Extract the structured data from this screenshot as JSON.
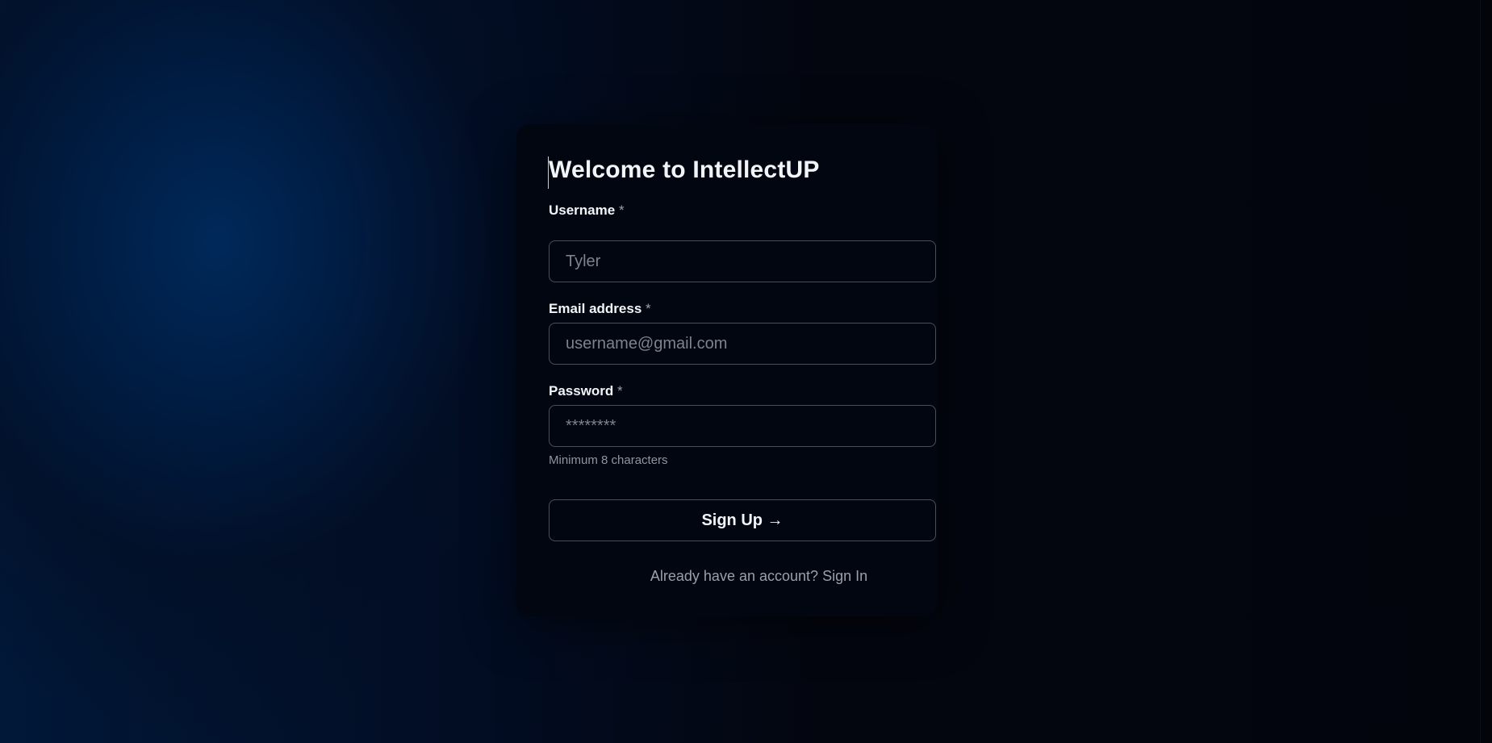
{
  "colors": {
    "background_accent": "#002a5c",
    "card_background": "#020611",
    "input_border": "#4a4f5a",
    "text_primary": "#f2f4f8",
    "text_muted": "#9aa0ab"
  },
  "form": {
    "title": "Welcome to IntellectUP",
    "username": {
      "label": "Username",
      "required_mark": "*",
      "placeholder": "Tyler",
      "value": ""
    },
    "email": {
      "label": "Email address",
      "required_mark": "*",
      "placeholder": "username@gmail.com",
      "value": ""
    },
    "password": {
      "label": "Password",
      "required_mark": "*",
      "placeholder": "********",
      "value": "",
      "hint": "Minimum 8 characters"
    },
    "submit_label": "Sign Up →",
    "footer": {
      "prompt": "Already have an account?",
      "link_label": "Sign In"
    }
  }
}
